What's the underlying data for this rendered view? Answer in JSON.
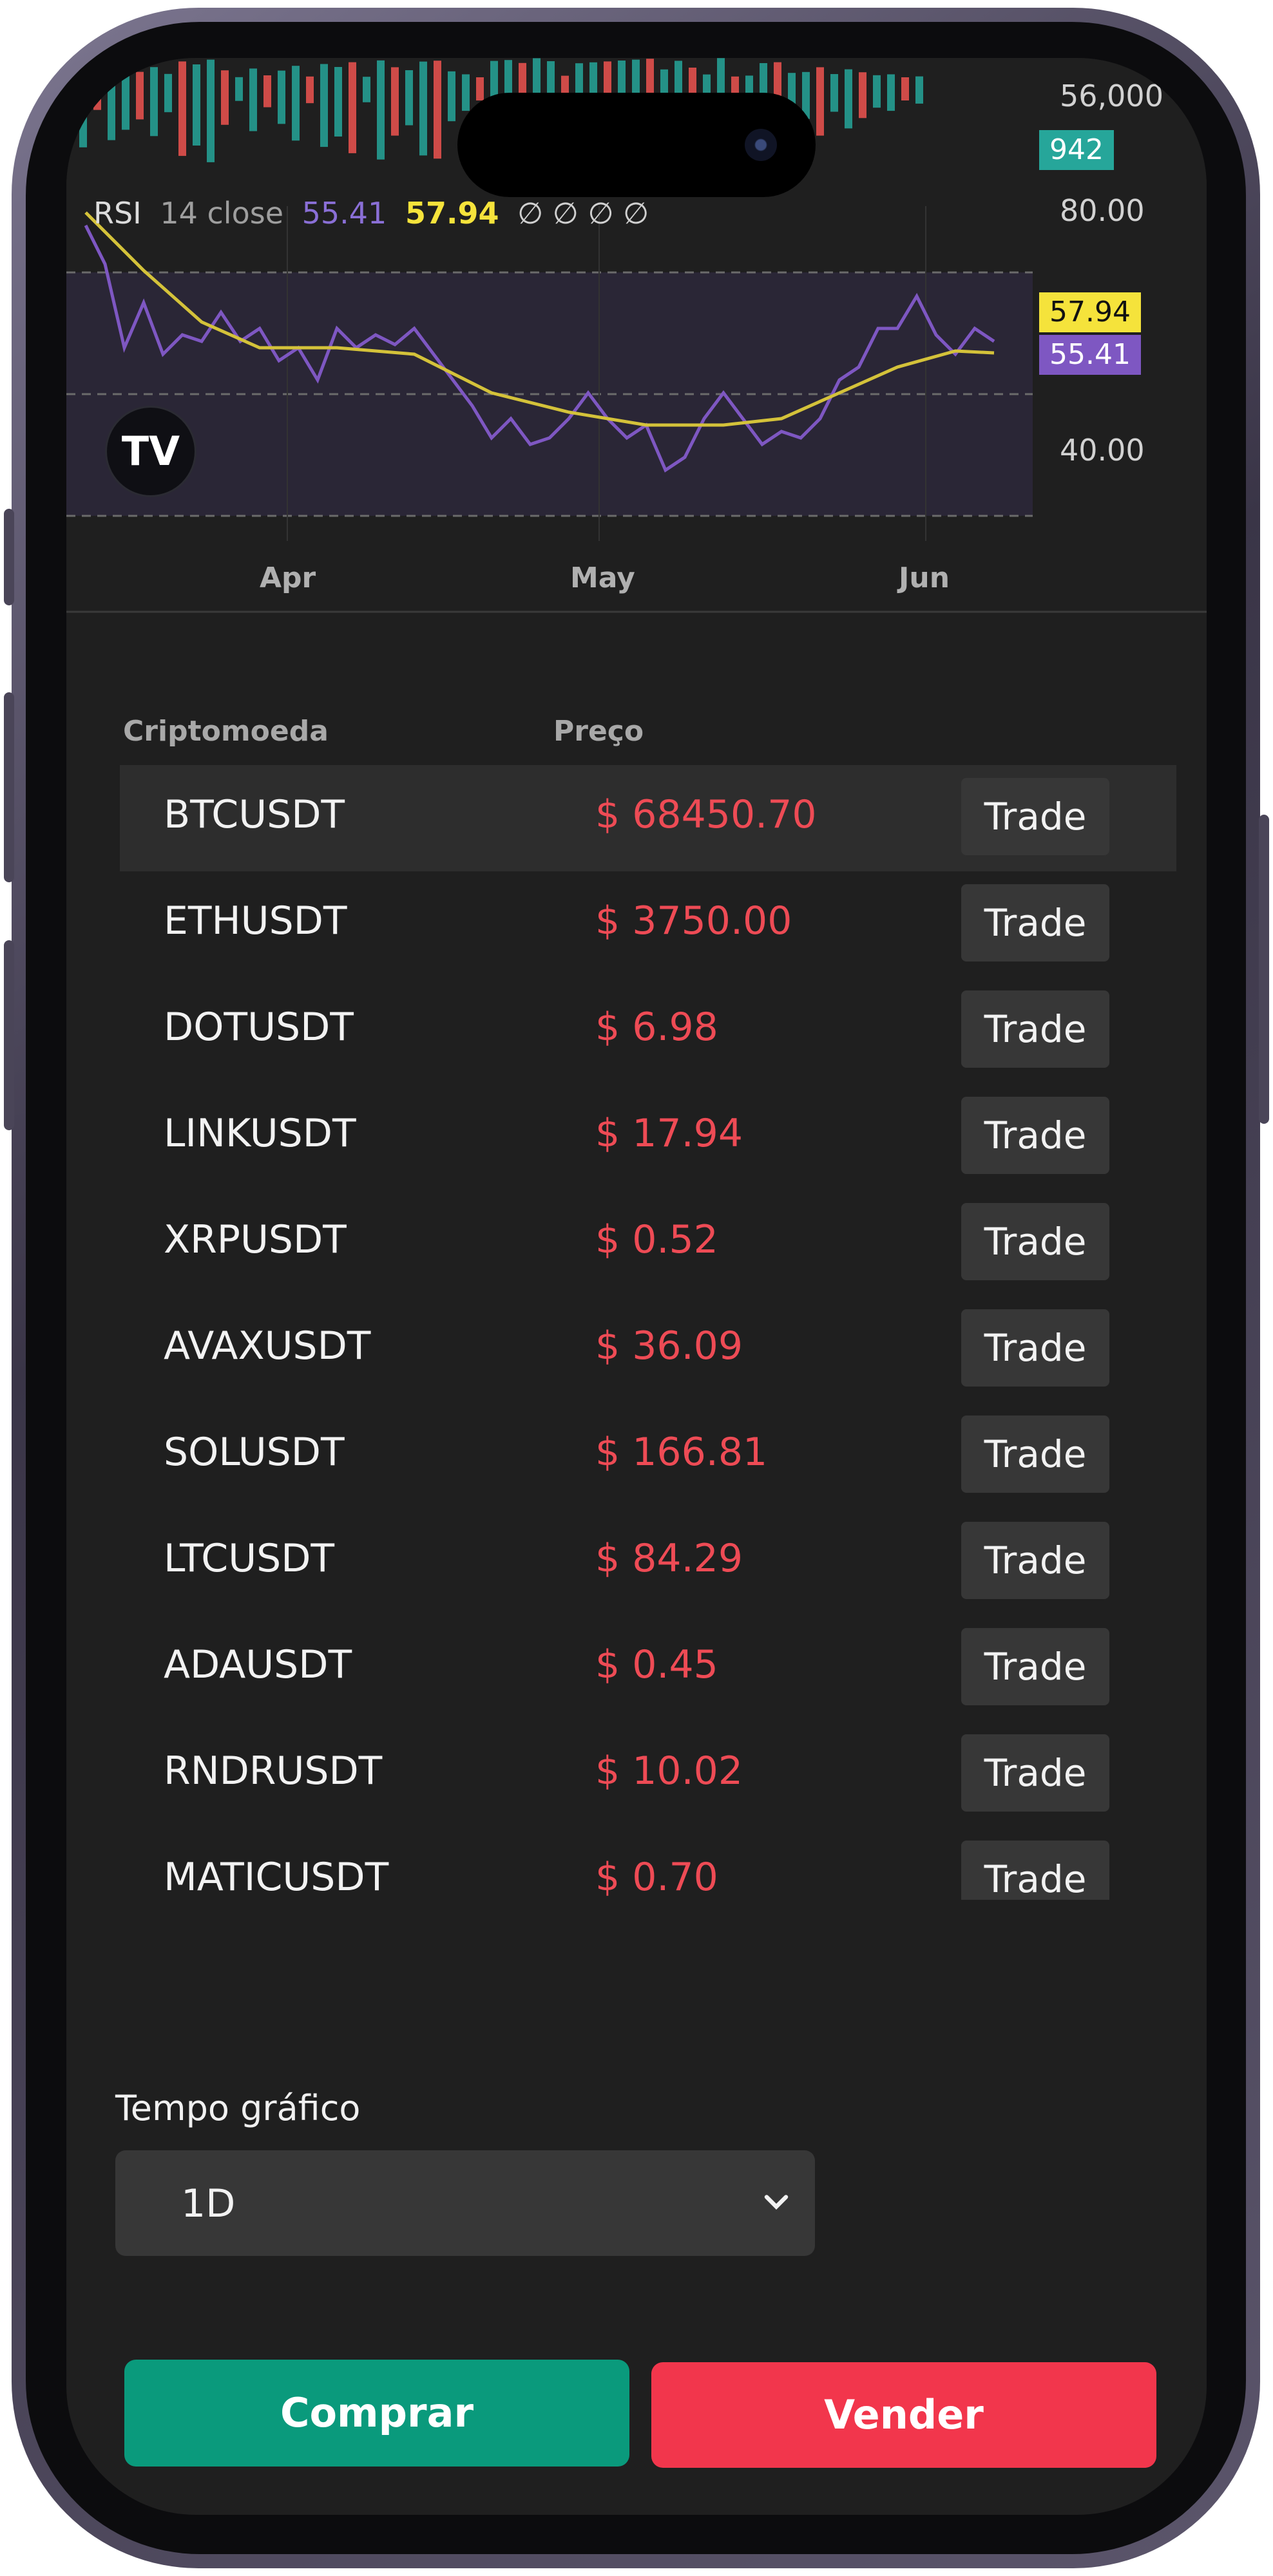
{
  "chart": {
    "price_axis_label": "56,000",
    "volume_badge": "942",
    "rsi_legend": {
      "name": "RSI",
      "params": "14 close",
      "rsi_value": "55.41",
      "ma_value": "57.94",
      "extras": "∅ ∅ ∅ ∅"
    },
    "rsi_axis": [
      "80.00",
      "40.00"
    ],
    "badges": {
      "ma": "57.94",
      "rsi": "55.41"
    },
    "months": [
      "Apr",
      "May",
      "Jun"
    ],
    "colors": {
      "rsi_line": "#7e57c2",
      "ma_line": "#d4c23a",
      "up_bar": "#26a69a",
      "down_bar": "#ef5350",
      "volume_badge": "#26a69a",
      "ma_badge": "#f5e33b",
      "rsi_badge": "#7e57c2"
    },
    "logo_icon": "tradingview-logo-icon",
    "settings_icon": "gear-icon"
  },
  "table": {
    "headers": {
      "symbol": "Criptomoeda",
      "price": "Preço"
    },
    "trade_label": "Trade",
    "rows": [
      {
        "symbol": "BTCUSDT",
        "price": "$ 68450.70"
      },
      {
        "symbol": "ETHUSDT",
        "price": "$ 3750.00"
      },
      {
        "symbol": "DOTUSDT",
        "price": "$ 6.98"
      },
      {
        "symbol": "LINKUSDT",
        "price": "$ 17.94"
      },
      {
        "symbol": "XRPUSDT",
        "price": "$ 0.52"
      },
      {
        "symbol": "AVAXUSDT",
        "price": "$ 36.09"
      },
      {
        "symbol": "SOLUSDT",
        "price": "$ 166.81"
      },
      {
        "symbol": "LTCUSDT",
        "price": "$ 84.29"
      },
      {
        "symbol": "ADAUSDT",
        "price": "$ 0.45"
      },
      {
        "symbol": "RNDRUSDT",
        "price": "$ 10.02"
      },
      {
        "symbol": "MATICUSDT",
        "price": "$ 0.70"
      }
    ]
  },
  "timeframe": {
    "label": "Tempo gráfico",
    "selected": "1D"
  },
  "actions": {
    "buy_label": "Comprar",
    "sell_label": "Vender"
  }
}
